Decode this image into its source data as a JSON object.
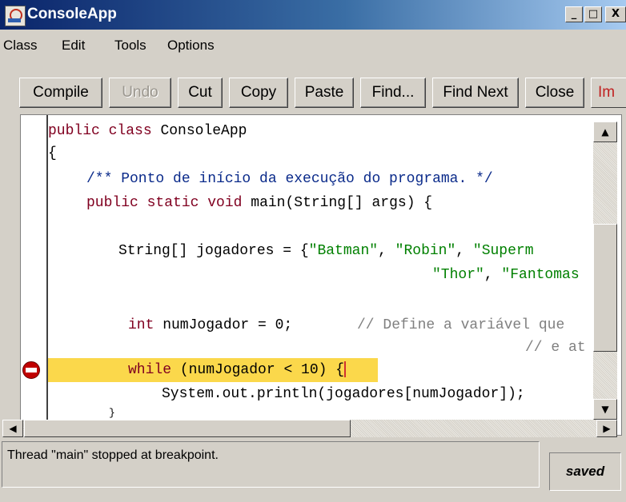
{
  "window": {
    "title": "ConsoleApp",
    "min_label": "_",
    "max_label": "□",
    "close_label": "X"
  },
  "menu": {
    "items": [
      "Class",
      "Edit",
      "Tools",
      "Options"
    ]
  },
  "toolbar": {
    "compile": "Compile",
    "undo": "Undo",
    "cut": "Cut",
    "copy": "Copy",
    "paste": "Paste",
    "find": "Find...",
    "find_next": "Find Next",
    "close": "Close",
    "implementation_partial": "Im"
  },
  "editor": {
    "lines": [
      {
        "kw1": "public",
        "kw2": "class",
        "rest": " ConsoleApp"
      },
      {
        "text": "{"
      },
      {
        "comment": "/** Ponto de início da execução do programa. */"
      },
      {
        "kw1": "public",
        "kw2": "static",
        "kw3": "void",
        "rest": " main(String[] args) {"
      },
      {
        "pre": "String[] jogadores = {",
        "s1": "\"Batman\"",
        "c1": ", ",
        "s2": "\"Robin\"",
        "c2": ", ",
        "s3": "\"Superm"
      },
      {
        "s4": "\"Thor\"",
        "c3": ", ",
        "s5": "\"Fantomas"
      },
      {
        "kw": "int",
        "rest": " numJogador = 0;",
        "comment": "// Define a variável que"
      },
      {
        "comment": "// e at"
      },
      {
        "kw": "while",
        "rest": " (numJogador < 10) {"
      },
      {
        "text": "System.out.println(jogadores[numJogador]);"
      },
      {
        "text": "}"
      }
    ],
    "breakpoint_line": 9
  },
  "status": {
    "message": "Thread \"main\" stopped at breakpoint.",
    "saved": "saved"
  }
}
